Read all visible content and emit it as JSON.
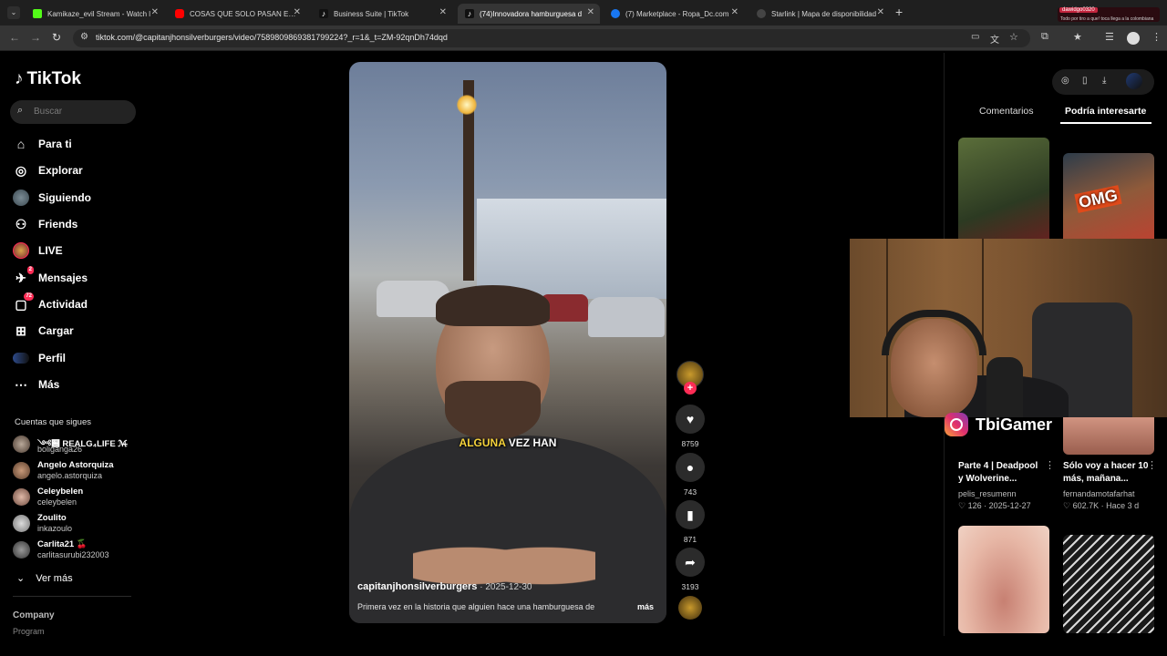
{
  "browser": {
    "tabs": [
      {
        "label": "Kamikaze_evil Stream - Watch l",
        "color": "#53fc18"
      },
      {
        "label": "COSAS QUE SOLO PASAN EN E",
        "color": "#ff0000"
      },
      {
        "label": "Business Suite | TikTok",
        "color": "#ffffff"
      },
      {
        "label": "(74)Innovadora hamburguesa d",
        "color": "#ffffff"
      },
      {
        "label": "(7) Marketplace - Ropa_Dc.com",
        "color": "#1877f2"
      },
      {
        "label": "Starlink | Mapa de disponibilidad",
        "color": "#9a9a9a"
      }
    ],
    "new_tab": "+",
    "url": "tiktok.com/@capitanjhonsilverburgers/video/7589809869381799224?_r=1&_t=ZM-92qnDh74dqd",
    "notification": {
      "title": "dawidgo0320",
      "message": "Todo por tiro a que! toca llega a la colombiana"
    }
  },
  "sidebar": {
    "logo": "TikTok",
    "search_placeholder": "Buscar",
    "nav": [
      {
        "label": "Para ti",
        "icon": "home-icon"
      },
      {
        "label": "Explorar",
        "icon": "compass-icon"
      },
      {
        "label": "Siguiendo",
        "icon": "following-avatar-icon"
      },
      {
        "label": "Friends",
        "icon": "friends-icon"
      },
      {
        "label": "LIVE",
        "icon": "live-icon"
      },
      {
        "label": "Mensajes",
        "icon": "message-icon",
        "badge": "2"
      },
      {
        "label": "Actividad",
        "icon": "activity-icon",
        "badge": "72"
      },
      {
        "label": "Cargar",
        "icon": "upload-icon"
      },
      {
        "label": "Perfil",
        "icon": "profile-icon"
      },
      {
        "label": "Más",
        "icon": "more-icon"
      }
    ],
    "following_title": "Cuentas que sigues",
    "accounts": [
      {
        "name": "༺฽ REALG₄LIFE ℳ̶",
        "handle": "boliganga26"
      },
      {
        "name": "Angelo Astorquiza",
        "handle": "angelo.astorquiza"
      },
      {
        "name": "Celeybelen",
        "handle": "celeybelen"
      },
      {
        "name": "Zoulito",
        "handle": "inkazoulo"
      },
      {
        "name": "Carlita21 🍒",
        "handle": "carlitasurubi232003"
      }
    ],
    "see_more": "Ver más",
    "company": "Company",
    "program": "Program"
  },
  "video": {
    "caption_highlight": "ALGUNA",
    "caption_rest": "VEZ HAN",
    "author": "capitanjhonsilverburgers",
    "date": " · 2025-12-30",
    "description": "Primera vez en la historia que alguien hace una hamburguesa de",
    "more": "más"
  },
  "actions": {
    "likes": "8759",
    "comments": "743",
    "saves": "871",
    "shares": "3193"
  },
  "right_panel": {
    "tabs": [
      "Comentarios",
      "Podría interesarte"
    ],
    "cards": [
      {
        "title": "Parte 4 | Deadpool y Wolverine...",
        "user": "pelis_resumenn",
        "stats": "♡ 126 · 2025-12-27"
      },
      {
        "title": "Sólo voy a hacer 10 más, mañana...",
        "user": "fernandamotafarhat",
        "stats": "♡ 602.7K · Hace 3 d"
      }
    ],
    "thumb_text": "OMG"
  },
  "overlay": {
    "instagram_name": "TbiGamer"
  }
}
